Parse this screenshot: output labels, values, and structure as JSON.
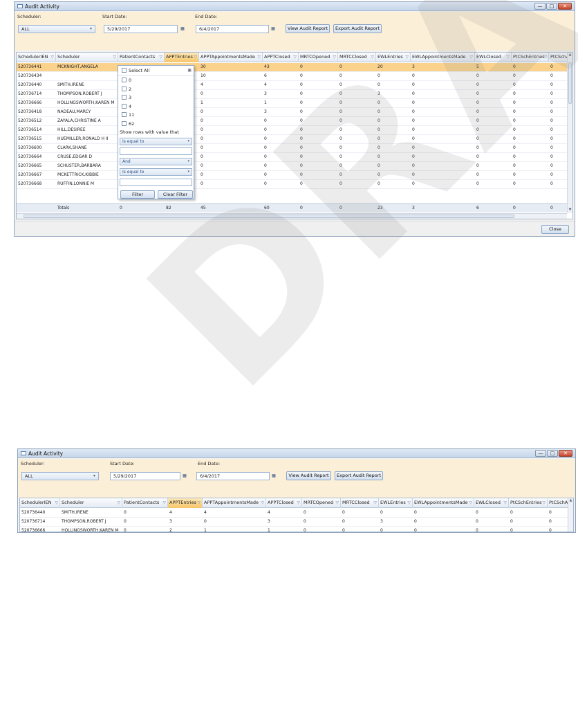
{
  "window1": {
    "title": "Audit Activity",
    "scheduler_label": "Scheduler:",
    "scheduler_value": "ALL",
    "start_label": "Start Date:",
    "start_value": "5/29/2017",
    "end_label": "End Date:",
    "end_value": "6/4/2017",
    "view_button": "View Audit Report",
    "export_button": "Export Audit Report",
    "close_button": "Close",
    "columns": [
      "SchedulerIEN",
      "Scheduler",
      "PatientContacts",
      "APPTEntries",
      "APPTAppointmentsMade",
      "APPTClosed",
      "MRTCOpened",
      "MRTCClosed",
      "EWLEntries",
      "EWLAppointmentsMade",
      "EWLClosed",
      "PtCSchEntries",
      "PtCSchApp"
    ],
    "rows": [
      [
        "520736441",
        "MCKNIGHT,ANGELA",
        "",
        "",
        "30",
        "43",
        "0",
        "0",
        "20",
        "3",
        "5",
        "0",
        "0"
      ],
      [
        "520736434",
        "",
        "",
        "",
        "10",
        "6",
        "0",
        "0",
        "0",
        "0",
        "0",
        "0",
        "0"
      ],
      [
        "520736440",
        "SMITH,IRENE",
        "",
        "",
        "4",
        "4",
        "0",
        "0",
        "0",
        "0",
        "0",
        "0",
        "0"
      ],
      [
        "520736714",
        "THOMPSON,ROBERT J",
        "",
        "",
        "0",
        "3",
        "0",
        "0",
        "3",
        "0",
        "0",
        "0",
        "0"
      ],
      [
        "520736666",
        "HOLLINGSWORTH,KAREN M",
        "",
        "",
        "1",
        "1",
        "0",
        "0",
        "0",
        "0",
        "0",
        "0",
        "0"
      ],
      [
        "520736418",
        "NADEAU,MARCY",
        "",
        "",
        "0",
        "3",
        "0",
        "0",
        "0",
        "0",
        "0",
        "0",
        "0"
      ],
      [
        "520736512",
        "ZAYALA,CHRISTINE A",
        "",
        "",
        "0",
        "0",
        "0",
        "0",
        "0",
        "0",
        "0",
        "0",
        "0"
      ],
      [
        "520736514",
        "HILL,DESIREE",
        "",
        "",
        "0",
        "0",
        "0",
        "0",
        "0",
        "0",
        "0",
        "0",
        "0"
      ],
      [
        "520736515",
        "HUEMILLER,RONALD H II",
        "",
        "",
        "0",
        "0",
        "0",
        "0",
        "0",
        "0",
        "0",
        "0",
        "0"
      ],
      [
        "520736600",
        "CLARK,SHANE",
        "",
        "",
        "0",
        "0",
        "0",
        "0",
        "0",
        "0",
        "0",
        "0",
        "0"
      ],
      [
        "520736664",
        "CRUSE,EDGAR D",
        "",
        "",
        "0",
        "0",
        "0",
        "0",
        "0",
        "0",
        "0",
        "0",
        "0"
      ],
      [
        "520736665",
        "SCHUSTER,BARBARA",
        "",
        "",
        "0",
        "0",
        "0",
        "0",
        "0",
        "0",
        "0",
        "0",
        "0"
      ],
      [
        "520736667",
        "MCKETTRICK,KIBBIE",
        "",
        "",
        "0",
        "0",
        "0",
        "0",
        "0",
        "0",
        "0",
        "0",
        "0"
      ],
      [
        "520736668",
        "RUFFIN,LONNIE M",
        "",
        "",
        "0",
        "0",
        "0",
        "0",
        "0",
        "0",
        "0",
        "0",
        "0"
      ]
    ],
    "totals": [
      "",
      "Totals",
      "0",
      "82",
      "45",
      "60",
      "0",
      "0",
      "23",
      "3",
      "6",
      "0",
      "0"
    ],
    "filter": {
      "select_all": "Select All",
      "values": [
        "0",
        "2",
        "3",
        "4",
        "11",
        "62"
      ],
      "show_rows": "Show rows with value that",
      "op1": "Is equal to",
      "conj": "And",
      "op2": "Is equal to",
      "filter_button": "Filter",
      "clear_button": "Clear Filter"
    }
  },
  "window2": {
    "title": "Audit Activity",
    "scheduler_label": "Scheduler:",
    "scheduler_value": "ALL",
    "start_label": "Start Date:",
    "start_value": "5/29/2017",
    "end_label": "End Date:",
    "end_value": "6/4/2017",
    "view_button": "View Audit Report",
    "export_button": "Export Audit Report",
    "columns": [
      "SchedulerIEN",
      "Scheduler",
      "PatientContacts",
      "APPTEntries",
      "APPTAppointmentsMade",
      "APPTClosed",
      "MRTCOpened",
      "MRTCClosed",
      "EWLEntries",
      "EWLAppointmentsMade",
      "EWLClosed",
      "PtCSchEntries",
      "PtCSchApp"
    ],
    "rows": [
      [
        "520736440",
        "SMITH,IRENE",
        "0",
        "4",
        "4",
        "4",
        "0",
        "0",
        "0",
        "0",
        "0",
        "0",
        "0"
      ],
      [
        "520736714",
        "THOMPSON,ROBERT J",
        "0",
        "3",
        "0",
        "3",
        "0",
        "0",
        "3",
        "0",
        "0",
        "0",
        "0"
      ],
      [
        "520736666",
        "HOLLINGSWORTH,KAREN M",
        "0",
        "2",
        "1",
        "1",
        "0",
        "0",
        "0",
        "0",
        "0",
        "0",
        "0"
      ]
    ]
  },
  "watermark": "DRAFT"
}
